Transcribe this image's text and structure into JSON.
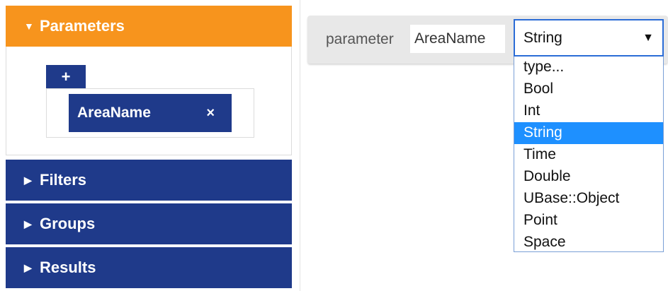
{
  "sidebar": {
    "sections": [
      {
        "label": "Parameters",
        "expanded": true
      },
      {
        "label": "Filters",
        "expanded": false
      },
      {
        "label": "Groups",
        "expanded": false
      },
      {
        "label": "Results",
        "expanded": false
      }
    ],
    "add_label": "+",
    "parameters": [
      {
        "name": "AreaName",
        "remove_label": "×"
      }
    ]
  },
  "editor": {
    "label": "parameter",
    "name_value": "AreaName",
    "type_selected": "String",
    "type_options": [
      "type...",
      "Bool",
      "Int",
      "String",
      "Time",
      "Double",
      "UBase::Object",
      "Point",
      "Space"
    ]
  },
  "colors": {
    "accent_orange": "#f7941d",
    "navy": "#1f3a8a",
    "selection_blue": "#1e90ff"
  }
}
